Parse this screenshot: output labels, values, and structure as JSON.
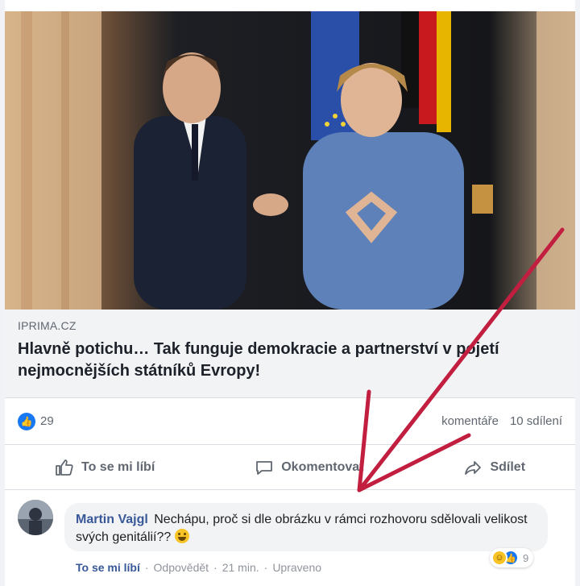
{
  "preview": {
    "domain": "IPRIMA.CZ",
    "headline": "Hlavně potichu… Tak funguje demokracie a partnerství v pojetí nejmocnějších státníků Evropy!"
  },
  "stats": {
    "likes": "29",
    "comments": "komentáře",
    "shares": "10 sdílení"
  },
  "actions": {
    "like": "To se mi líbí",
    "comment": "Okomentovat",
    "share": "Sdílet"
  },
  "comment": {
    "author": "Martin Vajgl",
    "text": "Nechápu, proč si dle obrázku v rámci rozhovoru sdělovali velikost svých genitálií??",
    "like_link": "To se mi líbí",
    "sep1": "·",
    "reply": "Odpovědět",
    "sep2": "·",
    "time": "21 min.",
    "sep3": "·",
    "edited": "Upraveno",
    "reaction_count": "9"
  },
  "colors": {
    "accent": "#1877f2",
    "link": "#385898",
    "arrow": "#c21e3f"
  },
  "icons": {
    "like": "thumbs-up-icon",
    "comment": "speech-bubble-icon",
    "share": "share-arrow-icon"
  }
}
